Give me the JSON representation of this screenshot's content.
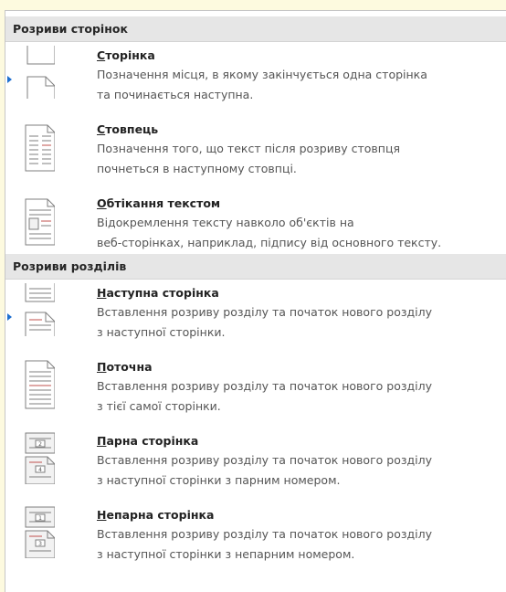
{
  "sections": [
    {
      "header": "Розриви сторінок",
      "items": [
        {
          "title": "Сторінка",
          "desc1": "Позначення місця, в якому закінчується одна сторінка",
          "desc2": "та починається наступна.",
          "icon": "page-break-icon"
        },
        {
          "title": "Стовпець",
          "desc1": "Позначення того, що текст після розриву стовпця",
          "desc2": "почнеться в наступному стовпці.",
          "icon": "column-break-icon"
        },
        {
          "title": "Обтікання текстом",
          "desc1": "Відокремлення тексту навколо об'єктів на",
          "desc2": "веб-сторінках, наприклад, підпису від основного тексту.",
          "icon": "text-wrapping-break-icon"
        }
      ]
    },
    {
      "header": "Розриви розділів",
      "items": [
        {
          "title": "Наступна сторінка",
          "desc1": "Вставлення розриву розділу та початок нового розділу",
          "desc2": "з наступної сторінки.",
          "icon": "next-page-section-icon"
        },
        {
          "title": "Поточна",
          "desc1": "Вставлення розриву розділу та початок нового розділу",
          "desc2": "з тієї самої сторінки.",
          "icon": "continuous-section-icon"
        },
        {
          "title": "Парна сторінка",
          "desc1": "Вставлення розриву розділу та початок нового розділу",
          "desc2": "з наступної сторінки з парним номером.",
          "icon": "even-page-section-icon",
          "icon_numbers": [
            "2",
            "4"
          ]
        },
        {
          "title": "Непарна сторінка",
          "desc1": "Вставлення розриву розділу та початок нового розділу",
          "desc2": "з наступної сторінки з непарним номером.",
          "icon": "odd-page-section-icon",
          "icon_numbers": [
            "1",
            "3"
          ]
        }
      ]
    }
  ],
  "colors": {
    "line": "#7f7f7f",
    "accent": "#c0504d",
    "marker": "#1e6fd0",
    "icon_bg": "#f2f2f2"
  }
}
